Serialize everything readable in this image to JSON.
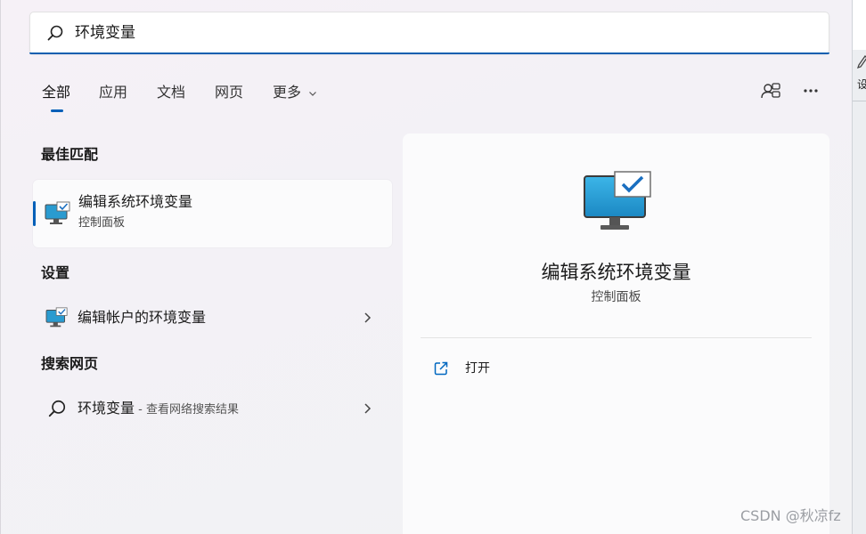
{
  "search": {
    "query": "环境变量"
  },
  "tabs": [
    {
      "label": "全部",
      "active": true
    },
    {
      "label": "应用"
    },
    {
      "label": "文档"
    },
    {
      "label": "网页"
    },
    {
      "label": "更多"
    }
  ],
  "sections": {
    "best_match": {
      "title": "最佳匹配",
      "item": {
        "name": "编辑系统环境变量",
        "subtitle": "控制面板",
        "icon": "system-properties-icon"
      }
    },
    "settings": {
      "title": "设置",
      "item": {
        "name": "编辑帐户的环境变量",
        "icon": "system-properties-icon"
      }
    },
    "web": {
      "title": "搜索网页",
      "item": {
        "name": "环境变量",
        "hint": " - 查看网络搜索结果",
        "icon": "search-icon"
      }
    }
  },
  "detail": {
    "title": "编辑系统环境变量",
    "subtitle": "控制面板",
    "actions": [
      {
        "label": "打开",
        "icon": "open-external-icon"
      }
    ]
  },
  "background_window": {
    "label": "设"
  },
  "watermark": "CSDN @秋凉fz",
  "colors": {
    "accent": "#005fb8",
    "search_underline": "#0a5fb0",
    "panel_bg": "#fbfbfc"
  }
}
